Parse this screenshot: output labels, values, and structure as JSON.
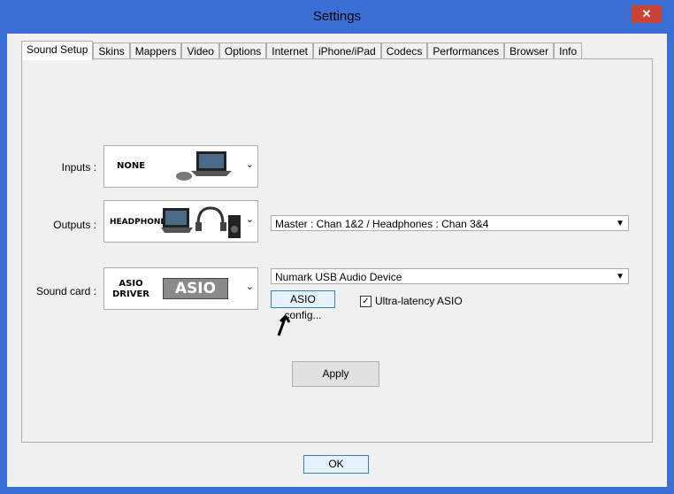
{
  "window": {
    "title": "Settings",
    "close_glyph": "✕"
  },
  "tabs": [
    {
      "label": "Sound Setup"
    },
    {
      "label": "Skins"
    },
    {
      "label": "Mappers"
    },
    {
      "label": "Video"
    },
    {
      "label": "Options"
    },
    {
      "label": "Internet"
    },
    {
      "label": "iPhone/iPad"
    },
    {
      "label": "Codecs"
    },
    {
      "label": "Performances"
    },
    {
      "label": "Browser"
    },
    {
      "label": "Info"
    }
  ],
  "sound_setup": {
    "inputs": {
      "label": "Inputs :",
      "selected": "NONE"
    },
    "outputs": {
      "label": "Outputs :",
      "selected": "HEADPHONES",
      "routing": "Master : Chan 1&2 / Headphones : Chan 3&4"
    },
    "sound_card": {
      "label": "Sound card :",
      "selected_line1": "ASIO",
      "selected_line2": "DRIVER",
      "logo_text": "ASIO",
      "device": "Numark USB Audio Device"
    },
    "asio_config_label": "ASIO config...",
    "ultra_latency": {
      "label": "Ultra-latency ASIO",
      "checked": true
    },
    "apply_label": "Apply"
  },
  "ok_label": "OK",
  "icons": {
    "dropdown": "chevron-down-icon",
    "close": "close-icon"
  },
  "colors": {
    "frame": "#3a6fd6",
    "close": "#c84437"
  }
}
